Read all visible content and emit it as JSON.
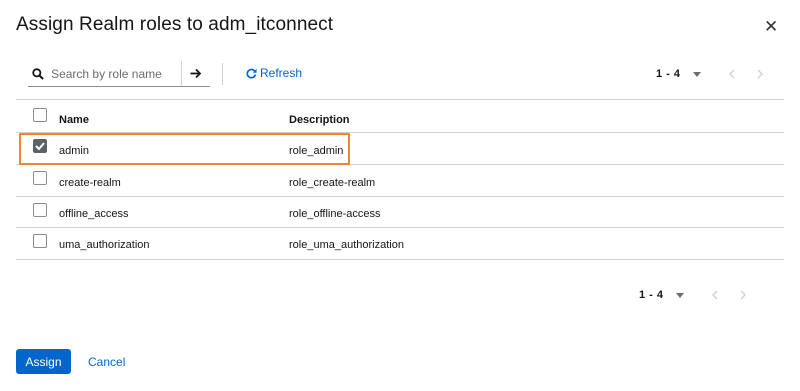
{
  "modal": {
    "title": "Assign Realm roles to adm_itconnect"
  },
  "toolbar": {
    "search_placeholder": "Search by role name",
    "refresh_label": "Refresh"
  },
  "pagination": {
    "range": "1 - 4"
  },
  "table": {
    "columns": [
      "Name",
      "Description"
    ],
    "rows": [
      {
        "name": "admin",
        "description": "role_admin",
        "checked": true
      },
      {
        "name": "create-realm",
        "description": "role_create-realm",
        "checked": false
      },
      {
        "name": "offline_access",
        "description": "role_offline-access",
        "checked": false
      },
      {
        "name": "uma_authorization",
        "description": "role_uma_authorization",
        "checked": false
      }
    ]
  },
  "footer": {
    "assign_label": "Assign",
    "cancel_label": "Cancel"
  },
  "colors": {
    "accent": "#0066cc",
    "highlight": "#ee8530",
    "checkbox_checked": "#5e6166"
  }
}
